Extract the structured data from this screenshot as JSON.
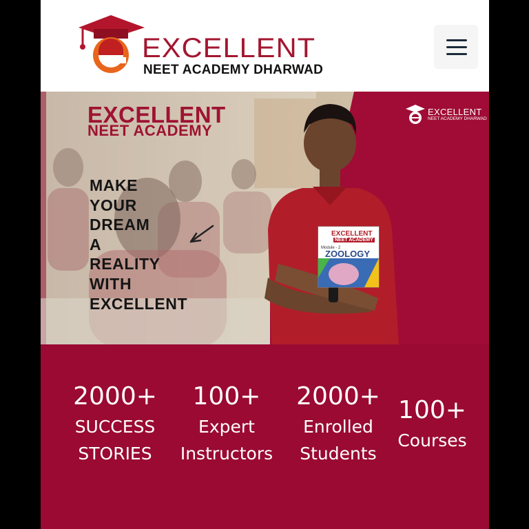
{
  "header": {
    "logo_title": "EXCELLENT",
    "logo_subtitle": "NEET ACADEMY DHARWAD",
    "logo_mark_letter": "e",
    "menu_icon": "hamburger-menu-icon"
  },
  "hero": {
    "headline_line1": "EXCELLENT",
    "headline_line2": "NEET ACADEMY",
    "tagline_lines": [
      "MAKE",
      "YOUR",
      "DREAM",
      "A",
      "REALITY",
      "WITH",
      "EXCELLENT"
    ],
    "mini_logo_title": "EXCELLENT",
    "mini_logo_subtitle": "NEET ACADEMY DHARWAD",
    "book_brand": "EXCELLENT",
    "book_brand_sub": "NEET ACADEMY",
    "book_module": "Module - 2",
    "book_subject": "ZOOLOGY",
    "arrow_icon": "arrow-icon"
  },
  "stats": [
    {
      "value": "2000+",
      "label_lines": [
        "SUCCESS",
        "STORIES"
      ]
    },
    {
      "value": "100+",
      "label_lines": [
        "Expert",
        "Instructors"
      ]
    },
    {
      "value": "2000+",
      "label_lines": [
        "Enrolled",
        "Students"
      ]
    },
    {
      "value": "100+",
      "label_lines": [
        "Courses"
      ]
    }
  ],
  "colors": {
    "brand_maroon": "#9a0a32",
    "logo_red": "#a3162f",
    "logo_orange": "#e8661c"
  }
}
